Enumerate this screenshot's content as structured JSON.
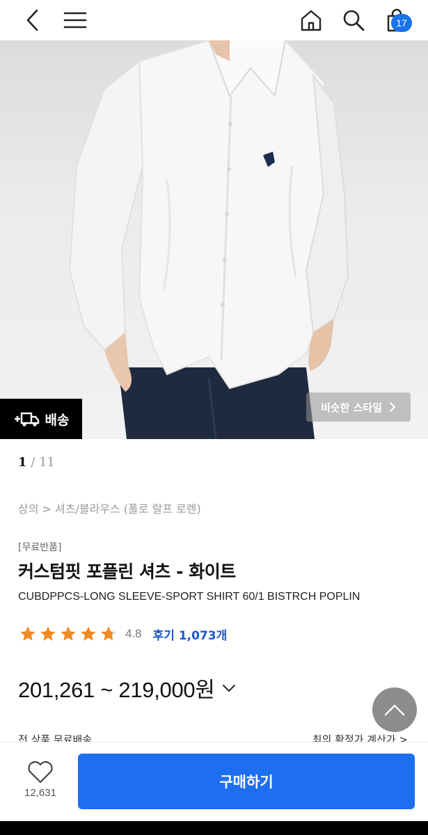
{
  "header": {
    "back_icon": "chevron-left-icon",
    "menu_icon": "hamburger-icon",
    "home_icon": "home-icon",
    "search_icon": "search-icon",
    "cart_icon": "shopping-bag-icon",
    "cart_count": "17"
  },
  "gallery": {
    "shipping_label": "배송",
    "shipping_icon": "fast-delivery-icon",
    "similar_style_label": "비슷한 스타일",
    "current": "1",
    "separator": "/",
    "total": "11"
  },
  "product": {
    "breadcrumb": "상의 > 셔츠/블라우스 (폴로 랄프 로렌)",
    "free_return": "[무료반품]",
    "title": "커스텀핏 포플린 셔츠 - 화이트",
    "subtitle": "CUBDPPCS-LONG SLEEVE-SPORT SHIRT 60/1 BISTRCH POPLIN",
    "rating": "4.8",
    "rating_value": 4.8,
    "reviews": "후기 1,073개",
    "price": "201,261 ~ 219,000원",
    "clipped_left": "전 상품 무료배송",
    "clipped_right": "최의 확정가 계산가 >"
  },
  "bottom": {
    "wish_count": "12,631",
    "buy_label": "구매하기"
  },
  "colors": {
    "accent": "#1e6ff0",
    "star": "#f08a24",
    "review_link": "#1a56c7"
  }
}
